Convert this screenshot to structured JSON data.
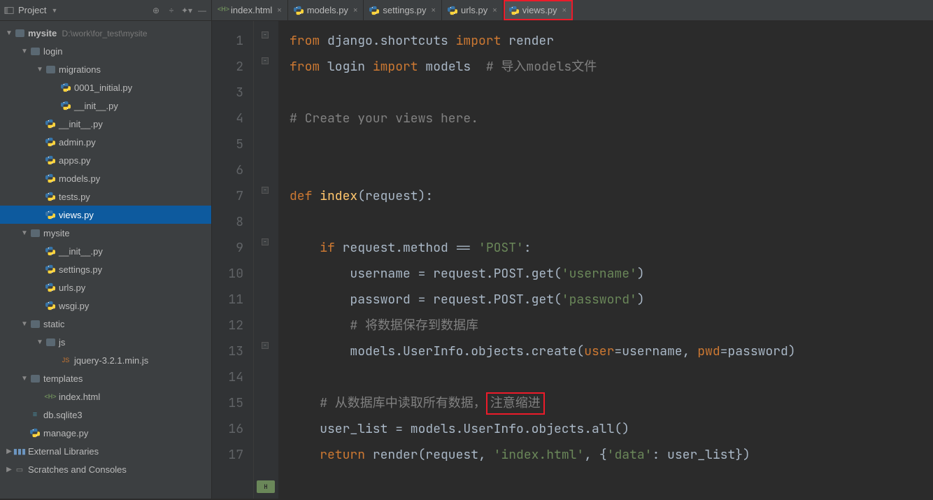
{
  "sidebar": {
    "title": "Project",
    "tree": [
      {
        "arrow": "▼",
        "depth": 0,
        "icon": "dir",
        "label": "mysite",
        "bold": true,
        "path": " D:\\work\\for_test\\mysite"
      },
      {
        "arrow": "▼",
        "depth": 1,
        "icon": "dir",
        "label": "login"
      },
      {
        "arrow": "▼",
        "depth": 2,
        "icon": "dir",
        "label": "migrations"
      },
      {
        "arrow": "",
        "depth": 3,
        "icon": "py",
        "label": "0001_initial.py"
      },
      {
        "arrow": "",
        "depth": 3,
        "icon": "py",
        "label": "__init__.py"
      },
      {
        "arrow": "",
        "depth": 2,
        "icon": "py",
        "label": "__init__.py"
      },
      {
        "arrow": "",
        "depth": 2,
        "icon": "py",
        "label": "admin.py"
      },
      {
        "arrow": "",
        "depth": 2,
        "icon": "py",
        "label": "apps.py"
      },
      {
        "arrow": "",
        "depth": 2,
        "icon": "py",
        "label": "models.py"
      },
      {
        "arrow": "",
        "depth": 2,
        "icon": "py",
        "label": "tests.py"
      },
      {
        "arrow": "",
        "depth": 2,
        "icon": "py",
        "label": "views.py",
        "selected": true
      },
      {
        "arrow": "▼",
        "depth": 1,
        "icon": "dir",
        "label": "mysite"
      },
      {
        "arrow": "",
        "depth": 2,
        "icon": "py",
        "label": "__init__.py"
      },
      {
        "arrow": "",
        "depth": 2,
        "icon": "py",
        "label": "settings.py"
      },
      {
        "arrow": "",
        "depth": 2,
        "icon": "py",
        "label": "urls.py"
      },
      {
        "arrow": "",
        "depth": 2,
        "icon": "py",
        "label": "wsgi.py"
      },
      {
        "arrow": "▼",
        "depth": 1,
        "icon": "dir",
        "label": "static"
      },
      {
        "arrow": "▼",
        "depth": 2,
        "icon": "dir",
        "label": "js"
      },
      {
        "arrow": "",
        "depth": 3,
        "icon": "js",
        "label": "jquery-3.2.1.min.js"
      },
      {
        "arrow": "▼",
        "depth": 1,
        "icon": "dir",
        "label": "templates"
      },
      {
        "arrow": "",
        "depth": 2,
        "icon": "html",
        "label": "index.html"
      },
      {
        "arrow": "",
        "depth": 1,
        "icon": "db",
        "label": "db.sqlite3"
      },
      {
        "arrow": "",
        "depth": 1,
        "icon": "py",
        "label": "manage.py"
      },
      {
        "arrow": "▶",
        "depth": 0,
        "icon": "lib",
        "label": "External Libraries"
      },
      {
        "arrow": "▶",
        "depth": 0,
        "icon": "scratch",
        "label": "Scratches and Consoles"
      }
    ]
  },
  "tabs": [
    {
      "icon": "html",
      "label": "index.html"
    },
    {
      "icon": "py",
      "label": "models.py"
    },
    {
      "icon": "py",
      "label": "settings.py"
    },
    {
      "icon": "py",
      "label": "urls.py"
    },
    {
      "icon": "py",
      "label": "views.py",
      "active": true,
      "highlighted": true
    }
  ],
  "code": {
    "lineNumbers": [
      "1",
      "2",
      "3",
      "4",
      "5",
      "6",
      "7",
      "8",
      "9",
      "10",
      "11",
      "12",
      "13",
      "14",
      "15",
      "16",
      "17"
    ],
    "lines": [
      [
        {
          "t": "from ",
          "c": "kw"
        },
        {
          "t": "django.shortcuts ",
          "c": "text"
        },
        {
          "t": "import ",
          "c": "kw"
        },
        {
          "t": "render",
          "c": "text"
        }
      ],
      [
        {
          "t": "from ",
          "c": "kw"
        },
        {
          "t": "login ",
          "c": "text"
        },
        {
          "t": "import ",
          "c": "kw"
        },
        {
          "t": "models  ",
          "c": "text"
        },
        {
          "t": "# 导入models文件",
          "c": "comment"
        }
      ],
      [],
      [
        {
          "t": "# Create your views here.",
          "c": "comment"
        }
      ],
      [],
      [],
      [
        {
          "t": "def ",
          "c": "kw"
        },
        {
          "t": "index",
          "c": "def"
        },
        {
          "t": "(request):",
          "c": "text"
        }
      ],
      [],
      [
        {
          "t": "    ",
          "c": "text"
        },
        {
          "t": "if ",
          "c": "kw"
        },
        {
          "t": "request.method == ",
          "c": "text"
        },
        {
          "t": "'POST'",
          "c": "str"
        },
        {
          "t": ":",
          "c": "text"
        }
      ],
      [
        {
          "t": "        username = request.POST.get(",
          "c": "text"
        },
        {
          "t": "'username'",
          "c": "str"
        },
        {
          "t": ")",
          "c": "text"
        }
      ],
      [
        {
          "t": "        password = request.POST.get(",
          "c": "text"
        },
        {
          "t": "'password'",
          "c": "str"
        },
        {
          "t": ")",
          "c": "text"
        }
      ],
      [
        {
          "t": "        ",
          "c": "text"
        },
        {
          "t": "# 将数据保存到数据库",
          "c": "comment"
        }
      ],
      [
        {
          "t": "        models.UserInfo.objects.create(",
          "c": "text"
        },
        {
          "t": "user",
          "c": "param"
        },
        {
          "t": "=username, ",
          "c": "text"
        },
        {
          "t": "pwd",
          "c": "param"
        },
        {
          "t": "=password)",
          "c": "text"
        }
      ],
      [],
      [
        {
          "t": "    ",
          "c": "text"
        },
        {
          "t": "# 从数据库中读取所有数据，",
          "c": "comment"
        },
        {
          "t": "注意缩进",
          "c": "comment",
          "box": true
        }
      ],
      [
        {
          "t": "    user_list = models.UserInfo.objects.all()",
          "c": "text"
        }
      ],
      [
        {
          "t": "    ",
          "c": "text"
        },
        {
          "t": "return ",
          "c": "kw"
        },
        {
          "t": "render(request, ",
          "c": "text"
        },
        {
          "t": "'index.html'",
          "c": "str"
        },
        {
          "t": ", {",
          "c": "text"
        },
        {
          "t": "'data'",
          "c": "str"
        },
        {
          "t": ": user_list})",
          "c": "text"
        }
      ]
    ]
  }
}
